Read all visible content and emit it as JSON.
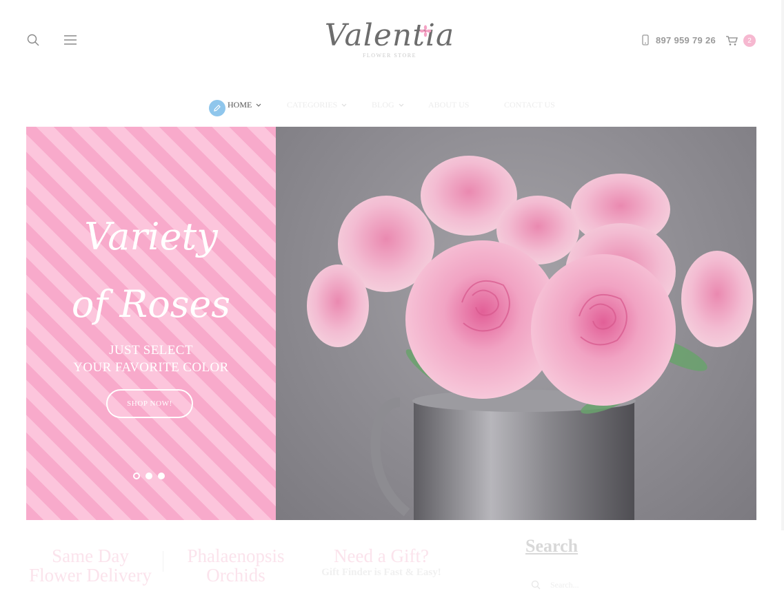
{
  "header": {
    "logo_text": "Valentia",
    "logo_tagline": "FLOWER STORE",
    "phone": "897 959 79 26",
    "cart_count": "2",
    "icons": [
      "search-icon",
      "menu-icon",
      "phone-icon",
      "cart-icon"
    ]
  },
  "nav": {
    "items": [
      {
        "label": "HOME",
        "has_dropdown": true,
        "active": true
      },
      {
        "label": "CATEGORIES",
        "has_dropdown": true,
        "active": false
      },
      {
        "label": "BLOG",
        "has_dropdown": true,
        "active": false
      },
      {
        "label": "ABOUT US",
        "has_dropdown": false,
        "active": false
      },
      {
        "label": "CONTACT US",
        "has_dropdown": false,
        "active": false
      }
    ]
  },
  "hero": {
    "title_line1": "Variety",
    "title_line2": "of Roses",
    "subtitle_line1": "JUST SELECT",
    "subtitle_line2": "YOUR FAVORITE COLOR",
    "button_label": "SHOP NOW!",
    "slides": 3,
    "active_slide": 1
  },
  "promos": [
    {
      "title_line1": "Same Day",
      "title_line2": "Flower Delivery"
    },
    {
      "title_line1": "Phalaenopsis",
      "title_line2": "Orchids"
    },
    {
      "title_line1": "Need a Gift?",
      "subtitle": "Gift Finder is Fast & Easy!"
    }
  ],
  "search_widget": {
    "title": "Search",
    "placeholder": "Search..."
  },
  "colors": {
    "accent_pink": "#f8aacb",
    "badge_pink": "#f6b8d0",
    "pencil_blue": "#8fc6ec"
  }
}
